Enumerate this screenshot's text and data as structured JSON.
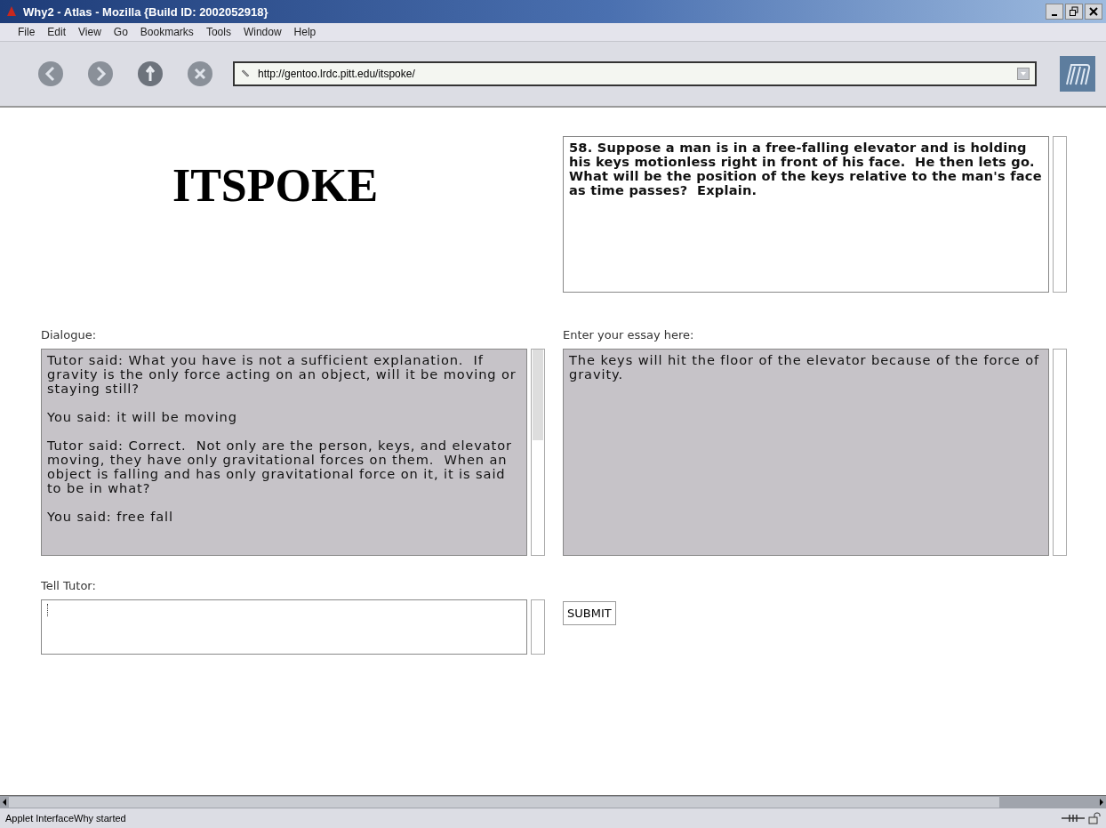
{
  "window": {
    "title": "Why2 - Atlas - Mozilla {Build ID: 2002052918}"
  },
  "menu": [
    "File",
    "Edit",
    "View",
    "Go",
    "Bookmarks",
    "Tools",
    "Window",
    "Help"
  ],
  "address_bar": {
    "value": "http://gentoo.lrdc.pitt.edu/itspoke/"
  },
  "page": {
    "logo": "ITSPOKE",
    "problem": "58. Suppose a man is in a free-falling elevator and is holding his keys motionless right in front of his face.  He then lets go. What will be the position of the keys relative to the man's face as time passes?  Explain.",
    "dialogue_label": "Dialogue:",
    "dialogue": [
      "Tutor said: What you have is not a sufficient explanation.  If gravity is the only force acting on an object, will it be moving or staying still?",
      "You said: it will be moving",
      "Tutor said: Correct.  Not only are the person, keys, and elevator moving, they have only gravitational forces on them.  When an object is falling and has only gravitational force on it, it is said to be in what?",
      "You said: free fall"
    ],
    "essay_label": "Enter your essay here:",
    "essay": "The keys will hit the floor of the elevator because of the force of gravity.",
    "tell_label": "Tell Tutor:",
    "submit": "SUBMIT"
  },
  "status_bar": {
    "text": "Applet InterfaceWhy started"
  }
}
